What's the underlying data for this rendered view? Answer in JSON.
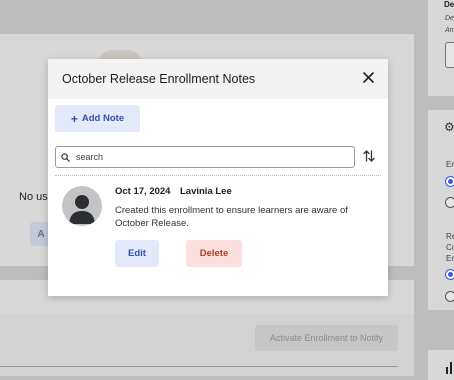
{
  "modal": {
    "title": "October Release Enrollment Notes",
    "add_note_label": "Add Note",
    "search": {
      "placeholder": "search",
      "value": ""
    }
  },
  "note": {
    "date": "Oct 17, 2024",
    "author": "Lavinia Lee",
    "body": "Created this enrollment to ensure learners are aware of October Release.",
    "edit_label": "Edit",
    "delete_label": "Delete"
  },
  "background": {
    "no_users_text": "No us",
    "button_a_label": "A",
    "activate_label": "Activate Enrollment to Notify",
    "right_header": "De",
    "right_small_1": "De",
    "right_small_2": "Am",
    "right_label_1": "Er",
    "right_label_2": "Re",
    "right_label_3": "Co",
    "right_label_4": "Er"
  },
  "icons": {
    "close": "close-icon",
    "add": "plus-icon",
    "search": "search-icon",
    "sort": "sort-icon",
    "avatar": "user-avatar-icon",
    "settings": "gear-icon",
    "chart": "bar-chart-icon"
  },
  "colors": {
    "accent": "#3552b0",
    "accent_bg": "#e3e9f8",
    "danger": "#b4382c",
    "danger_bg": "#fbe0dd",
    "overlay": "#bdbdbd"
  }
}
